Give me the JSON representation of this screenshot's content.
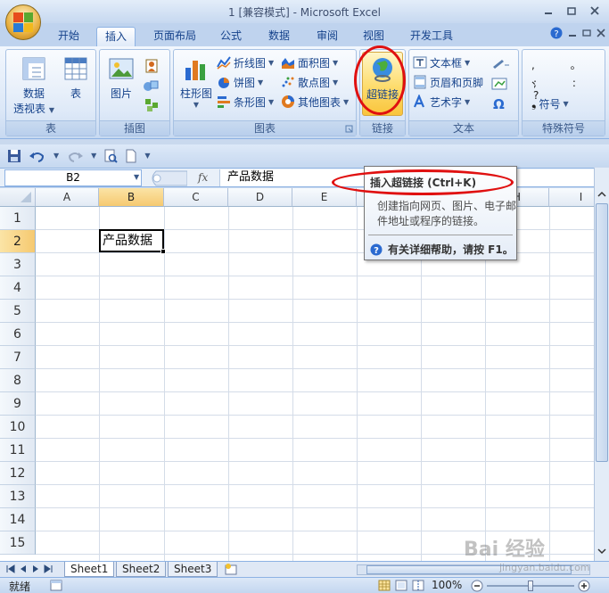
{
  "window": {
    "title": "1  [兼容模式] - Microsoft Excel"
  },
  "tabs": [
    {
      "label": "开始"
    },
    {
      "label": "插入"
    },
    {
      "label": "页面布局"
    },
    {
      "label": "公式"
    },
    {
      "label": "数据"
    },
    {
      "label": "审阅"
    },
    {
      "label": "视图"
    },
    {
      "label": "开发工具"
    }
  ],
  "active_tab": "插入",
  "ribbon": {
    "tables": {
      "name": "表",
      "pivot_label_1": "数据",
      "pivot_label_2": "透视表",
      "table_label": "表"
    },
    "illustrations": {
      "name": "插图",
      "picture_label": "图片"
    },
    "charts": {
      "name": "图表",
      "column_label": "柱形图",
      "line_label": "折线图",
      "pie_label": "饼图",
      "bar_label": "条形图",
      "area_label": "面积图",
      "scatter_label": "散点图",
      "other_label": "其他图表"
    },
    "links": {
      "name": "链接",
      "hyperlink_label": "超链接"
    },
    "text": {
      "name": "文本",
      "textbox_label": "文本框",
      "header_footer_label": "页眉和页脚",
      "wordart_label": "艺术字",
      "omega": "Ω"
    },
    "symbols": {
      "name": "特殊符号",
      "symbol_label": "符号"
    }
  },
  "formula_bar": {
    "name_box": "B2",
    "fx": "fx",
    "value": "产品数据"
  },
  "sheet": {
    "columns": [
      "A",
      "B",
      "C",
      "D",
      "E",
      "F",
      "G",
      "H",
      "I"
    ],
    "rows": [
      "1",
      "2",
      "3",
      "4",
      "5",
      "6",
      "7",
      "8",
      "9",
      "10",
      "11",
      "12",
      "13",
      "14",
      "15"
    ],
    "active_cell_value": "产品数据"
  },
  "tooltip": {
    "title": "插入超链接 (Ctrl+K)",
    "desc": "创建指向网页、图片、电子邮件地址或程序的链接。",
    "help": "有关详细帮助，请按 F1。"
  },
  "sheet_tabs": [
    {
      "label": "Sheet1"
    },
    {
      "label": "Sheet2"
    },
    {
      "label": "Sheet3"
    }
  ],
  "status": {
    "ready": "就绪",
    "zoom": "100%"
  },
  "watermark": {
    "text": "Bai 经验",
    "url": "jingyan.baidu.com"
  },
  "colors": {
    "accent": "#15428b",
    "highlight": "#e01010",
    "selected_header": "#f6c970"
  }
}
